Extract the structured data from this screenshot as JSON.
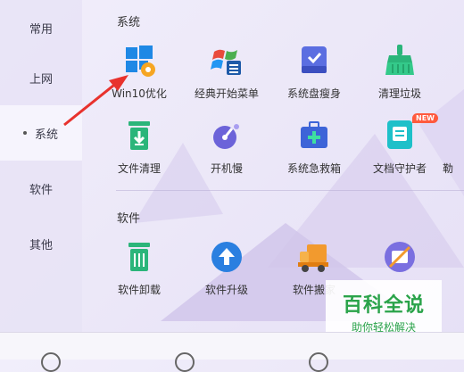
{
  "sidebar": {
    "items": [
      {
        "label": "常用"
      },
      {
        "label": "上网"
      },
      {
        "label": "系统"
      },
      {
        "label": "软件"
      },
      {
        "label": "其他"
      }
    ]
  },
  "sections": {
    "system": {
      "title": "系统",
      "tiles": [
        {
          "label": "Win10优化",
          "icon": "windows-gear-icon"
        },
        {
          "label": "经典开始菜单",
          "icon": "start-menu-icon"
        },
        {
          "label": "系统盘瘦身",
          "icon": "disk-slim-icon"
        },
        {
          "label": "清理垃圾",
          "icon": "broom-icon"
        },
        {
          "label": "文件清理",
          "icon": "trash-download-icon"
        },
        {
          "label": "开机慢",
          "icon": "boot-speed-icon"
        },
        {
          "label": "系统急救箱",
          "icon": "first-aid-kit-icon"
        },
        {
          "label": "文档守护者",
          "icon": "document-guard-icon",
          "badge": "NEW"
        },
        {
          "label": "勒"
        }
      ]
    },
    "software": {
      "title": "软件",
      "tiles": [
        {
          "label": "软件卸载",
          "icon": "uninstall-icon"
        },
        {
          "label": "软件升级",
          "icon": "upgrade-icon"
        },
        {
          "label": "软件搬家",
          "icon": "truck-icon"
        },
        {
          "label": "",
          "icon": "no-ads-icon"
        }
      ]
    }
  },
  "watermark": {
    "main": "百科全说",
    "sub": "助你轻松解决"
  },
  "colors": {
    "accent_green": "#2aa34a",
    "arrow_red": "#e8322d"
  }
}
